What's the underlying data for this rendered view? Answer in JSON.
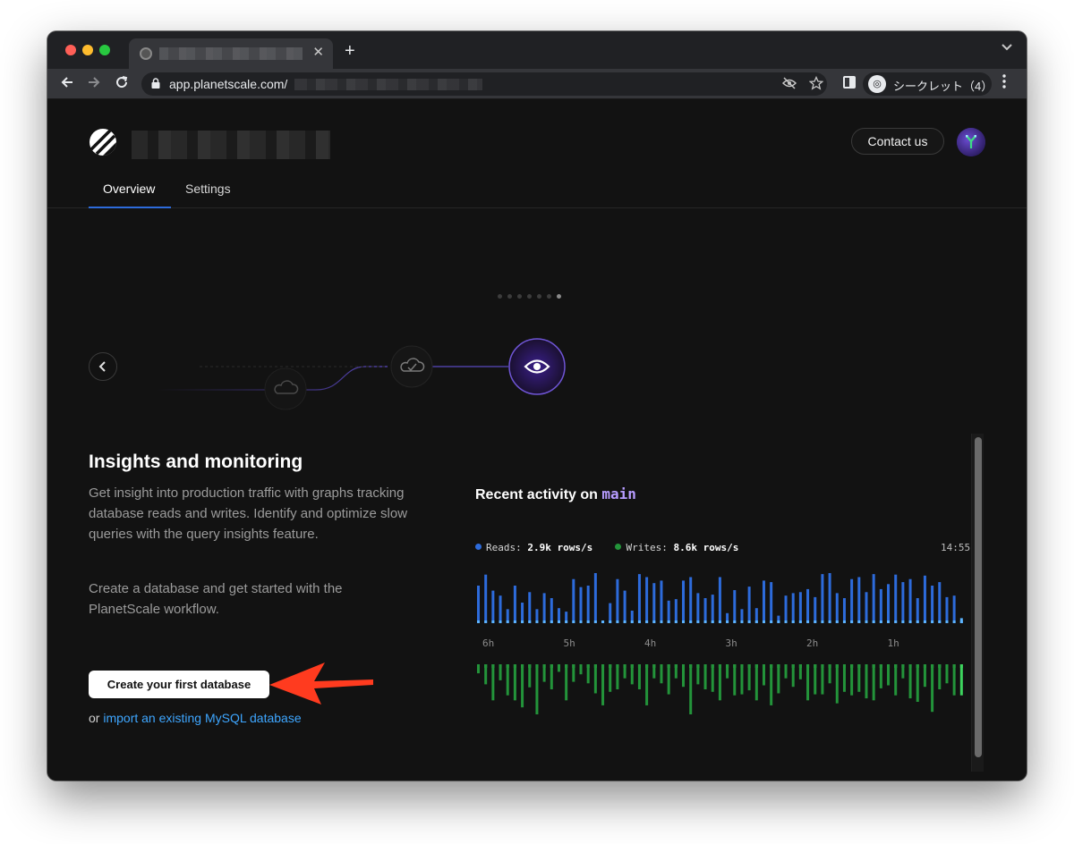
{
  "browser": {
    "address_domain": "app.planetscale.com/",
    "new_tab_symbol": "+",
    "tab_close_symbol": "✕",
    "incognito_label": "シークレット（4）"
  },
  "header": {
    "contact_label": "Contact us"
  },
  "nav_tabs": [
    {
      "label": "Overview",
      "active": true
    },
    {
      "label": "Settings",
      "active": false
    }
  ],
  "carousel": {
    "slide_count": 7,
    "active_index": 6,
    "steps": [
      "cloud-icon",
      "cloud-check-icon",
      "eye-icon"
    ]
  },
  "intro": {
    "heading": "Insights and monitoring",
    "paragraph1": "Get insight into production traffic with graphs tracking database reads and writes. Identify and optimize slow queries with the query insights feature.",
    "paragraph2": "Create a database and get started with the PlanetScale workflow.",
    "create_button": "Create your first database",
    "import_prefix": "or ",
    "import_link": "import an existing MySQL database"
  },
  "activity": {
    "title_prefix": "Recent activity on ",
    "branch": "main",
    "reads_label": "Reads:",
    "reads_value": "2.9k rows/s",
    "writes_label": "Writes:",
    "writes_value": "8.6k rows/s",
    "timestamp": "14:55",
    "colors": {
      "reads": "#2d6bdb",
      "writes": "#23943a",
      "reads_latest": "#5cb4ff",
      "writes_latest": "#3dd45e"
    }
  },
  "chart_data": {
    "type": "bar",
    "x_tick_labels": [
      "6h",
      "5h",
      "4h",
      "3h",
      "2h",
      "1h"
    ],
    "series": [
      {
        "name": "Reads",
        "values": [
          0.75,
          0.97,
          0.65,
          0.55,
          0.28,
          0.75,
          0.41,
          0.62,
          0.28,
          0.6,
          0.5,
          0.3,
          0.23,
          0.88,
          0.72,
          0.75,
          1.0,
          0.05,
          0.4,
          0.88,
          0.65,
          0.25,
          0.98,
          0.92,
          0.8,
          0.85,
          0.45,
          0.48,
          0.85,
          0.92,
          0.6,
          0.5,
          0.57,
          0.92,
          0.2,
          0.66,
          0.28,
          0.73,
          0.3,
          0.85,
          0.82,
          0.15,
          0.55,
          0.6,
          0.62,
          0.68,
          0.52,
          0.98,
          1.0,
          0.6,
          0.5,
          0.88,
          0.92,
          0.62,
          0.98,
          0.68,
          0.78,
          0.97,
          0.82,
          0.88,
          0.5,
          0.95,
          0.75,
          0.82,
          0.52,
          0.55,
          0.1
        ]
      },
      {
        "name": "Writes",
        "values": [
          0.18,
          0.4,
          0.72,
          0.32,
          0.62,
          0.72,
          0.86,
          0.46,
          1.0,
          0.35,
          0.5,
          0.15,
          0.72,
          0.35,
          0.2,
          0.38,
          0.58,
          0.82,
          0.55,
          0.5,
          0.28,
          0.4,
          0.5,
          0.82,
          0.28,
          0.38,
          0.6,
          0.28,
          0.45,
          1.0,
          0.4,
          0.5,
          0.55,
          0.72,
          0.28,
          0.62,
          0.6,
          0.52,
          0.72,
          0.42,
          0.82,
          0.58,
          0.28,
          0.45,
          0.3,
          0.72,
          0.6,
          0.6,
          0.38,
          0.78,
          0.55,
          0.62,
          0.55,
          0.68,
          0.72,
          0.48,
          0.42,
          0.62,
          0.28,
          0.68,
          0.75,
          0.45,
          0.95,
          0.5,
          0.38,
          0.62,
          0.62
        ]
      }
    ]
  }
}
